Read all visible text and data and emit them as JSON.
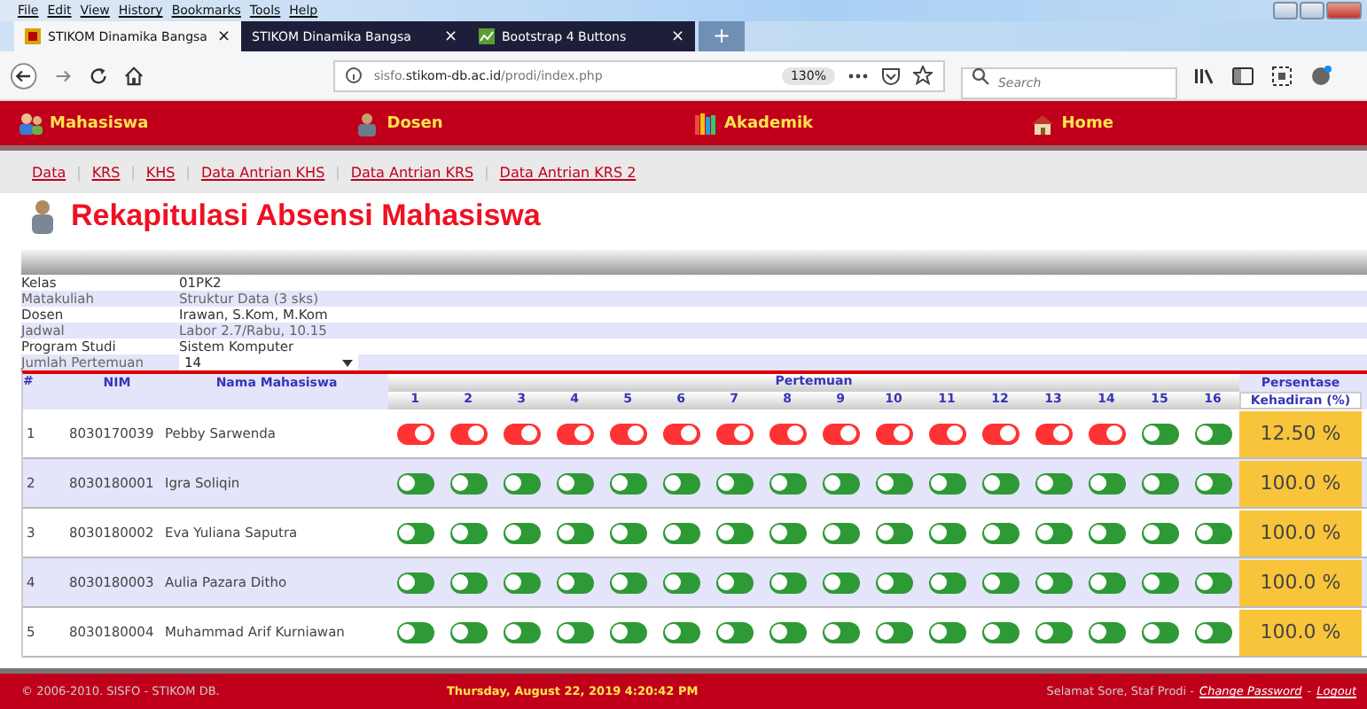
{
  "browser": {
    "menu": [
      "File",
      "Edit",
      "View",
      "History",
      "Bookmarks",
      "Tools",
      "Help"
    ],
    "tabs": [
      {
        "title": "STIKOM Dinamika Bangsa",
        "selected": true,
        "close": "×"
      },
      {
        "title": "STIKOM Dinamika Bangsa",
        "selected": false,
        "close": "×"
      },
      {
        "title": "Bootstrap 4 Buttons",
        "selected": false,
        "close": "×"
      }
    ],
    "new_tab": "+",
    "url": "sisfo.**stikom-db.ac.id**/prodi/index.php",
    "zoom": "130%",
    "search_placeholder": "Search"
  },
  "main_menu": [
    "Mahasiswa",
    "Dosen",
    "Akademik",
    "Home"
  ],
  "sub_menu_separator": "|",
  "sub_menu": [
    "Data",
    "KRS",
    "KHS",
    "Data Antrian KHS",
    "Data Antrian KRS",
    "Data Antrian KRS 2"
  ],
  "title": "Rekapitulasi Absensi Mahasiswa",
  "info": [
    {
      "label": "Kelas",
      "value": "01PK2"
    },
    {
      "label": "Matakuliah",
      "value": "Struktur Data (3 sks)"
    },
    {
      "label": "Dosen",
      "value": "Irawan, S.Kom, M.Kom"
    },
    {
      "label": "Jadwal",
      "value": "Labor 2.7/Rabu, 10.15"
    },
    {
      "label": "Program Studi",
      "value": "Sistem Komputer"
    }
  ],
  "meetings": {
    "label": "Jumlah Pertemuan",
    "value": "14"
  },
  "table": {
    "col_no": "#",
    "col_nim": "NIM",
    "col_name": "Nama Mahasiswa",
    "col_meetings": "Pertemuan",
    "meeting_numbers": [
      "1",
      "2",
      "3",
      "4",
      "5",
      "6",
      "7",
      "8",
      "9",
      "10",
      "11",
      "12",
      "13",
      "14",
      "15",
      "16"
    ],
    "col_percent_1": "Persentase",
    "col_percent_2": "Kehadiran (%)",
    "rows": [
      {
        "no": "1",
        "nim": "8030170039",
        "name": "Pebby Sarwenda",
        "absent": [
          true,
          true,
          true,
          true,
          true,
          true,
          true,
          true,
          true,
          true,
          true,
          true,
          true,
          true,
          false,
          false
        ],
        "percent": "12.50 %"
      },
      {
        "no": "2",
        "nim": "8030180001",
        "name": "Igra Soliqin",
        "absent": [
          false,
          false,
          false,
          false,
          false,
          false,
          false,
          false,
          false,
          false,
          false,
          false,
          false,
          false,
          false,
          false
        ],
        "percent": "100.0 %"
      },
      {
        "no": "3",
        "nim": "8030180002",
        "name": "Eva Yuliana Saputra",
        "absent": [
          false,
          false,
          false,
          false,
          false,
          false,
          false,
          false,
          false,
          false,
          false,
          false,
          false,
          false,
          false,
          false
        ],
        "percent": "100.0 %"
      },
      {
        "no": "4",
        "nim": "8030180003",
        "name": "Aulia Pazara Ditho",
        "absent": [
          false,
          false,
          false,
          false,
          false,
          false,
          false,
          false,
          false,
          false,
          false,
          false,
          false,
          false,
          false,
          false
        ],
        "percent": "100.0 %"
      },
      {
        "no": "5",
        "nim": "8030180004",
        "name": "Muhammad Arif Kurniawan",
        "absent": [
          false,
          false,
          false,
          false,
          false,
          false,
          false,
          false,
          false,
          false,
          false,
          false,
          false,
          false,
          false,
          false
        ],
        "percent": "100.0 %"
      }
    ]
  },
  "footer": {
    "copyright": "© 2006-2010. SISFO - STIKOM DB.",
    "datetime": "Thursday, August 22, 2019 4:20:42 PM",
    "greeting": "Selamat Sore, Staf Prodi -",
    "links": [
      "Change Password",
      "Logout"
    ],
    "separator": "-"
  }
}
